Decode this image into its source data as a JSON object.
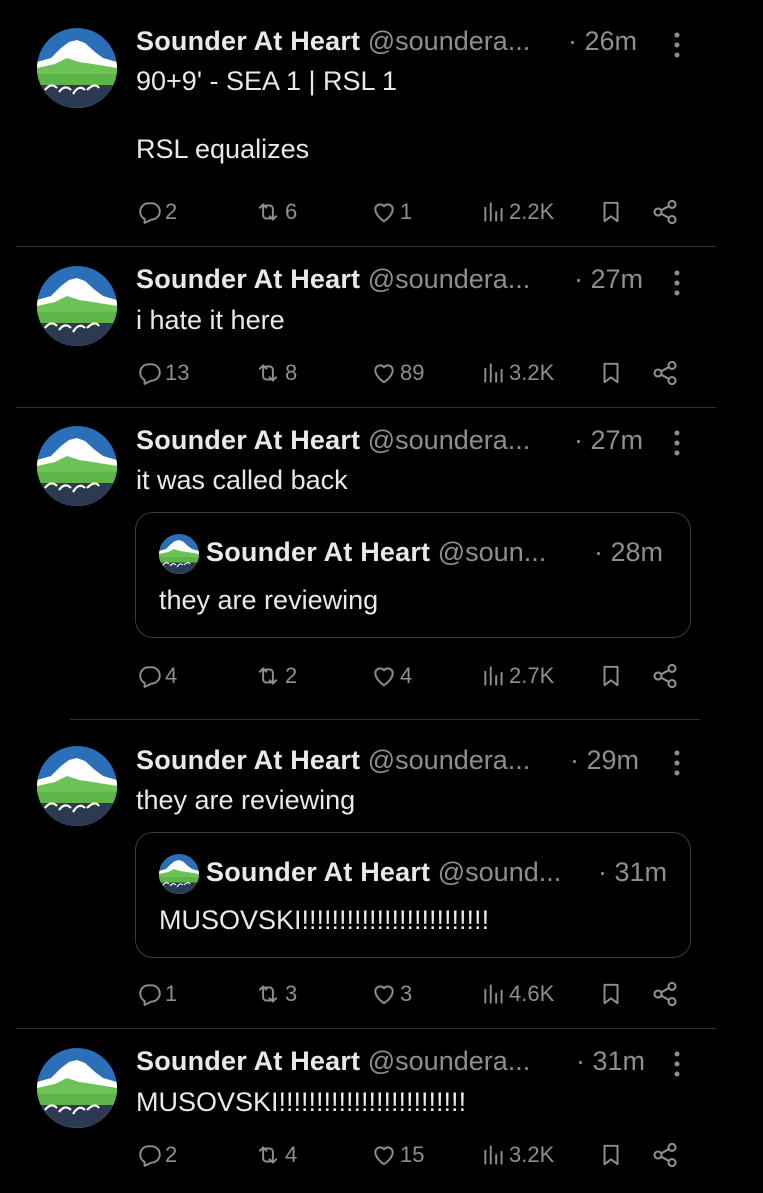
{
  "colors": {
    "background": "#000000",
    "text_primary": "#e7e9ea",
    "text_secondary": "#8b8f94",
    "divider": "#2f3336"
  },
  "author": {
    "display_name": "Sounder At Heart",
    "avatar_icon": "sounder-at-heart-logo-icon"
  },
  "tweets": [
    {
      "handle": "@soundera...",
      "time": "· 26m",
      "text": "90+9' - SEA 1 | RSL 1\n\nRSL equalizes",
      "replies": "2",
      "retweets": "6",
      "likes": "1",
      "views": "2.2K"
    },
    {
      "handle": "@soundera...",
      "time": "· 27m",
      "text": "i hate it here",
      "replies": "13",
      "retweets": "8",
      "likes": "89",
      "views": "3.2K"
    },
    {
      "handle": "@soundera...",
      "time": "· 27m",
      "text": "it was called back",
      "quote": {
        "display_name": "Sounder At Heart",
        "handle": "@soun...",
        "time": "· 28m",
        "text": "they are reviewing"
      },
      "replies": "4",
      "retweets": "2",
      "likes": "4",
      "views": "2.7K"
    },
    {
      "handle": "@soundera...",
      "time": "· 29m",
      "text": "they are reviewing",
      "quote": {
        "display_name": "Sounder At Heart",
        "handle": "@sound...",
        "time": "· 31m",
        "text": "MUSOVSKI!!!!!!!!!!!!!!!!!!!!!!!!!"
      },
      "replies": "1",
      "retweets": "3",
      "likes": "3",
      "views": "4.6K"
    },
    {
      "handle": "@soundera...",
      "time": "· 31m",
      "text": "MUSOVSKI!!!!!!!!!!!!!!!!!!!!!!!!!",
      "replies": "2",
      "retweets": "4",
      "likes": "15",
      "views": "3.2K"
    }
  ]
}
